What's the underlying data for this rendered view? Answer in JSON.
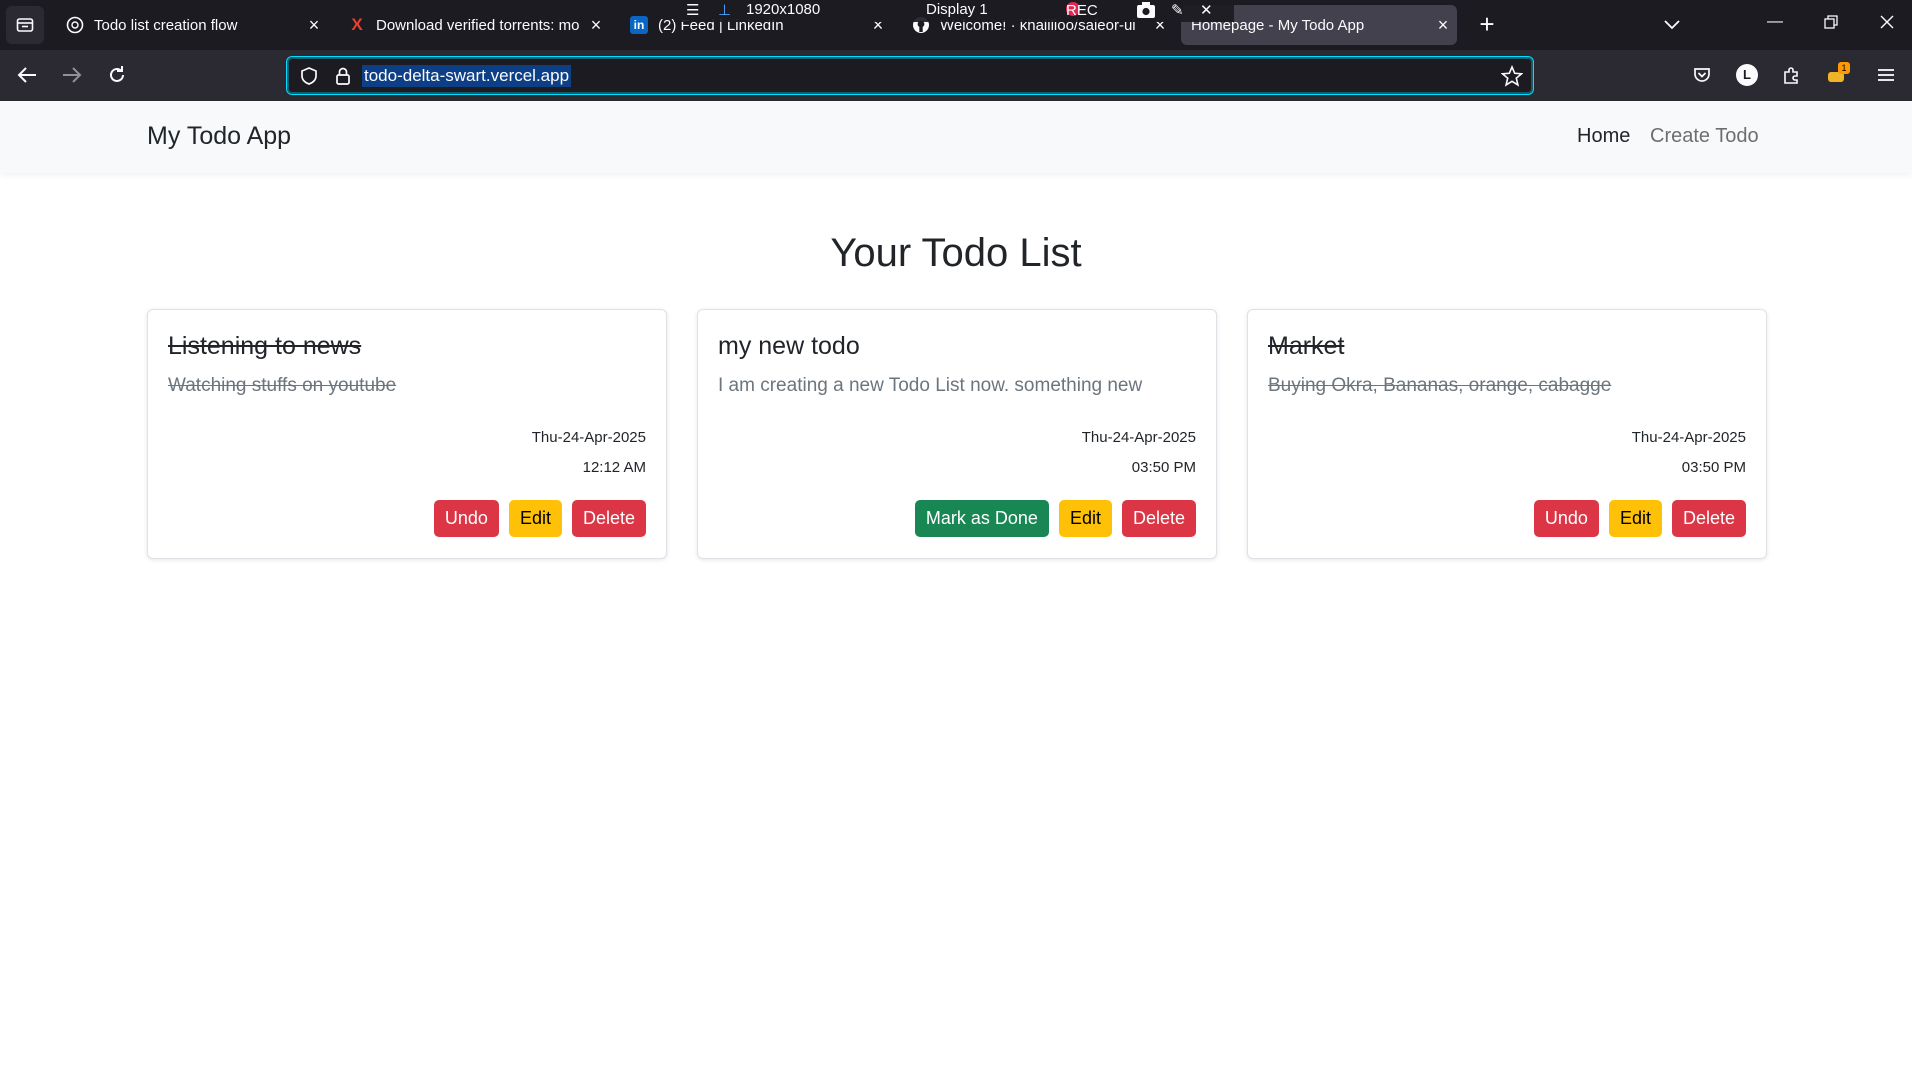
{
  "browser": {
    "tabs": [
      {
        "title": "Todo list creation flow",
        "favicon": "openai-icon"
      },
      {
        "title": "Download verified torrents: mo",
        "favicon": "x-icon"
      },
      {
        "title": "(2) Feed | LinkedIn",
        "favicon": "linkedin-icon"
      },
      {
        "title": "Welcome! · khalilioo/saleor-ui",
        "favicon": "github-icon"
      },
      {
        "title": "Homepage - My Todo App",
        "favicon": "",
        "active": true
      }
    ],
    "url": "todo-delta-swart.vercel.app",
    "recording_overlay": {
      "resolution": "1920x1080",
      "display": "Display 1",
      "status": "REC"
    },
    "account_initial": "L",
    "extension_badge": "1"
  },
  "app": {
    "brand": "My Todo App",
    "nav": [
      {
        "label": "Home",
        "active": true
      },
      {
        "label": "Create Todo",
        "active": false
      }
    ],
    "heading": "Your Todo List",
    "todos": [
      {
        "title": "Listening to news",
        "description": "Watching stuffs on youtube",
        "date": "Thu-24-Apr-2025",
        "time": "12:12 AM",
        "done": true,
        "actions": [
          "Undo",
          "Edit",
          "Delete"
        ]
      },
      {
        "title": "my new todo",
        "description": "I am creating a new Todo List now. something new",
        "date": "Thu-24-Apr-2025",
        "time": "03:50 PM",
        "done": false,
        "actions": [
          "Mark as Done",
          "Edit",
          "Delete"
        ]
      },
      {
        "title": "Market",
        "description": "Buying Okra, Bananas, orange, cabagge",
        "date": "Thu-24-Apr-2025",
        "time": "03:50 PM",
        "done": true,
        "actions": [
          "Undo",
          "Edit",
          "Delete"
        ]
      }
    ]
  },
  "colors": {
    "danger": "#dc3545",
    "warning": "#ffc107",
    "success": "#198754",
    "navbar_bg": "#f8f9fa"
  }
}
